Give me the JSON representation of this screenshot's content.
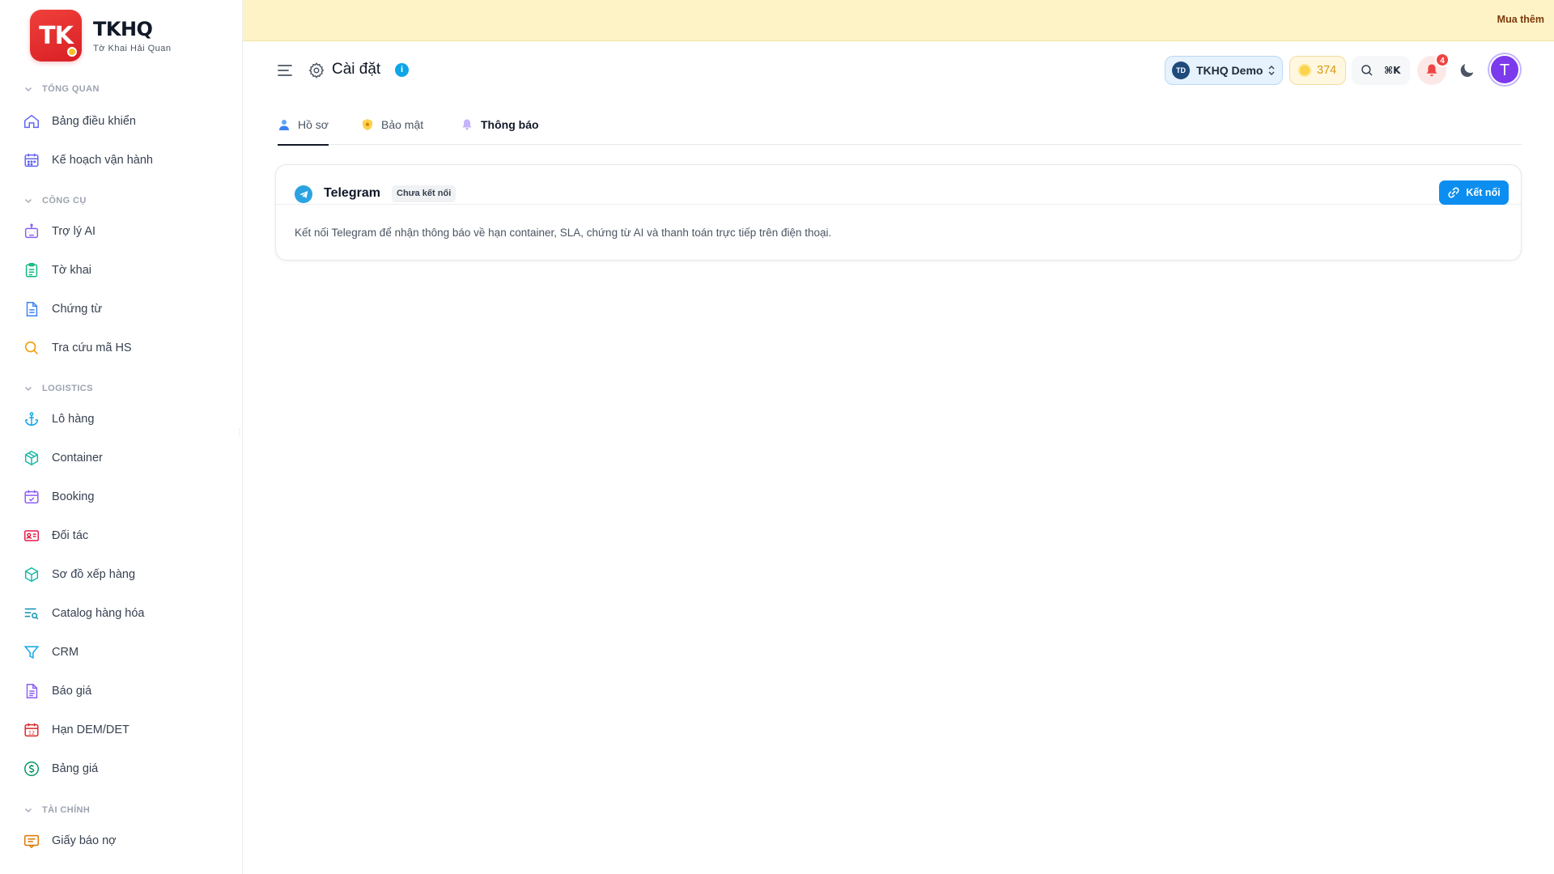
{
  "brand": {
    "logo_text": "TK",
    "title": "TKHQ",
    "subtitle": "Tờ Khai Hải Quan"
  },
  "sidebar": {
    "sections": [
      {
        "title": "TỔNG QUAN",
        "items": [
          {
            "label": "Bảng điều khiển",
            "icon": "home-icon"
          },
          {
            "label": "Kế hoạch vận hành",
            "icon": "calendar-icon"
          }
        ]
      },
      {
        "title": "CÔNG CỤ",
        "items": [
          {
            "label": "Trợ lý AI",
            "icon": "bot-icon"
          },
          {
            "label": "Tờ khai",
            "icon": "clipboard-icon"
          },
          {
            "label": "Chứng từ",
            "icon": "document-icon"
          },
          {
            "label": "Tra cứu mã HS",
            "icon": "search-icon"
          }
        ]
      },
      {
        "title": "LOGISTICS",
        "items": [
          {
            "label": "Lô hàng",
            "icon": "ship-icon"
          },
          {
            "label": "Container",
            "icon": "box-icon"
          },
          {
            "label": "Booking",
            "icon": "calendar-check-icon"
          },
          {
            "label": "Đối tác",
            "icon": "id-card-icon"
          },
          {
            "label": "Sơ đồ xếp hàng",
            "icon": "cube-icon"
          },
          {
            "label": "Catalog hàng hóa",
            "icon": "list-search-icon"
          },
          {
            "label": "CRM",
            "icon": "funnel-icon"
          },
          {
            "label": "Báo giá",
            "icon": "file-text-icon"
          },
          {
            "label": "Hạn DEM/DET",
            "icon": "calendar-12-icon"
          },
          {
            "label": "Bảng giá",
            "icon": "dollar-circle-icon"
          }
        ]
      },
      {
        "title": "TÀI CHÍNH",
        "items": [
          {
            "label": "Giấy báo nợ",
            "icon": "receipt-icon"
          }
        ]
      }
    ]
  },
  "banner": {
    "link_label": "Mua thêm"
  },
  "header": {
    "page_title": "Cài đặt",
    "workspace": {
      "badge": "TD",
      "name": "TKHQ Demo"
    },
    "credits": "374",
    "search_shortcut": "⌘K",
    "notification_count": "4",
    "avatar_initial": "T"
  },
  "tabs": [
    {
      "label": "Hồ sơ",
      "icon": "user-icon"
    },
    {
      "label": "Bảo mật",
      "icon": "shield-icon"
    },
    {
      "label": "Thông báo",
      "icon": "bell-icon"
    }
  ],
  "telegram_card": {
    "title": "Telegram",
    "status": "Chưa kết nối",
    "connect_label": "Kết nối",
    "description": "Kết nối Telegram để nhận thông báo về hạn container, SLA, chứng từ AI và thanh toán trực tiếp trên điện thoại."
  },
  "colors": {
    "brand_red": "#e5302f",
    "primary_blue": "#0b8ef0",
    "banner_bg": "#fef3c7",
    "avatar_purple": "#7c3aed",
    "credit_gold": "#d49a12"
  }
}
